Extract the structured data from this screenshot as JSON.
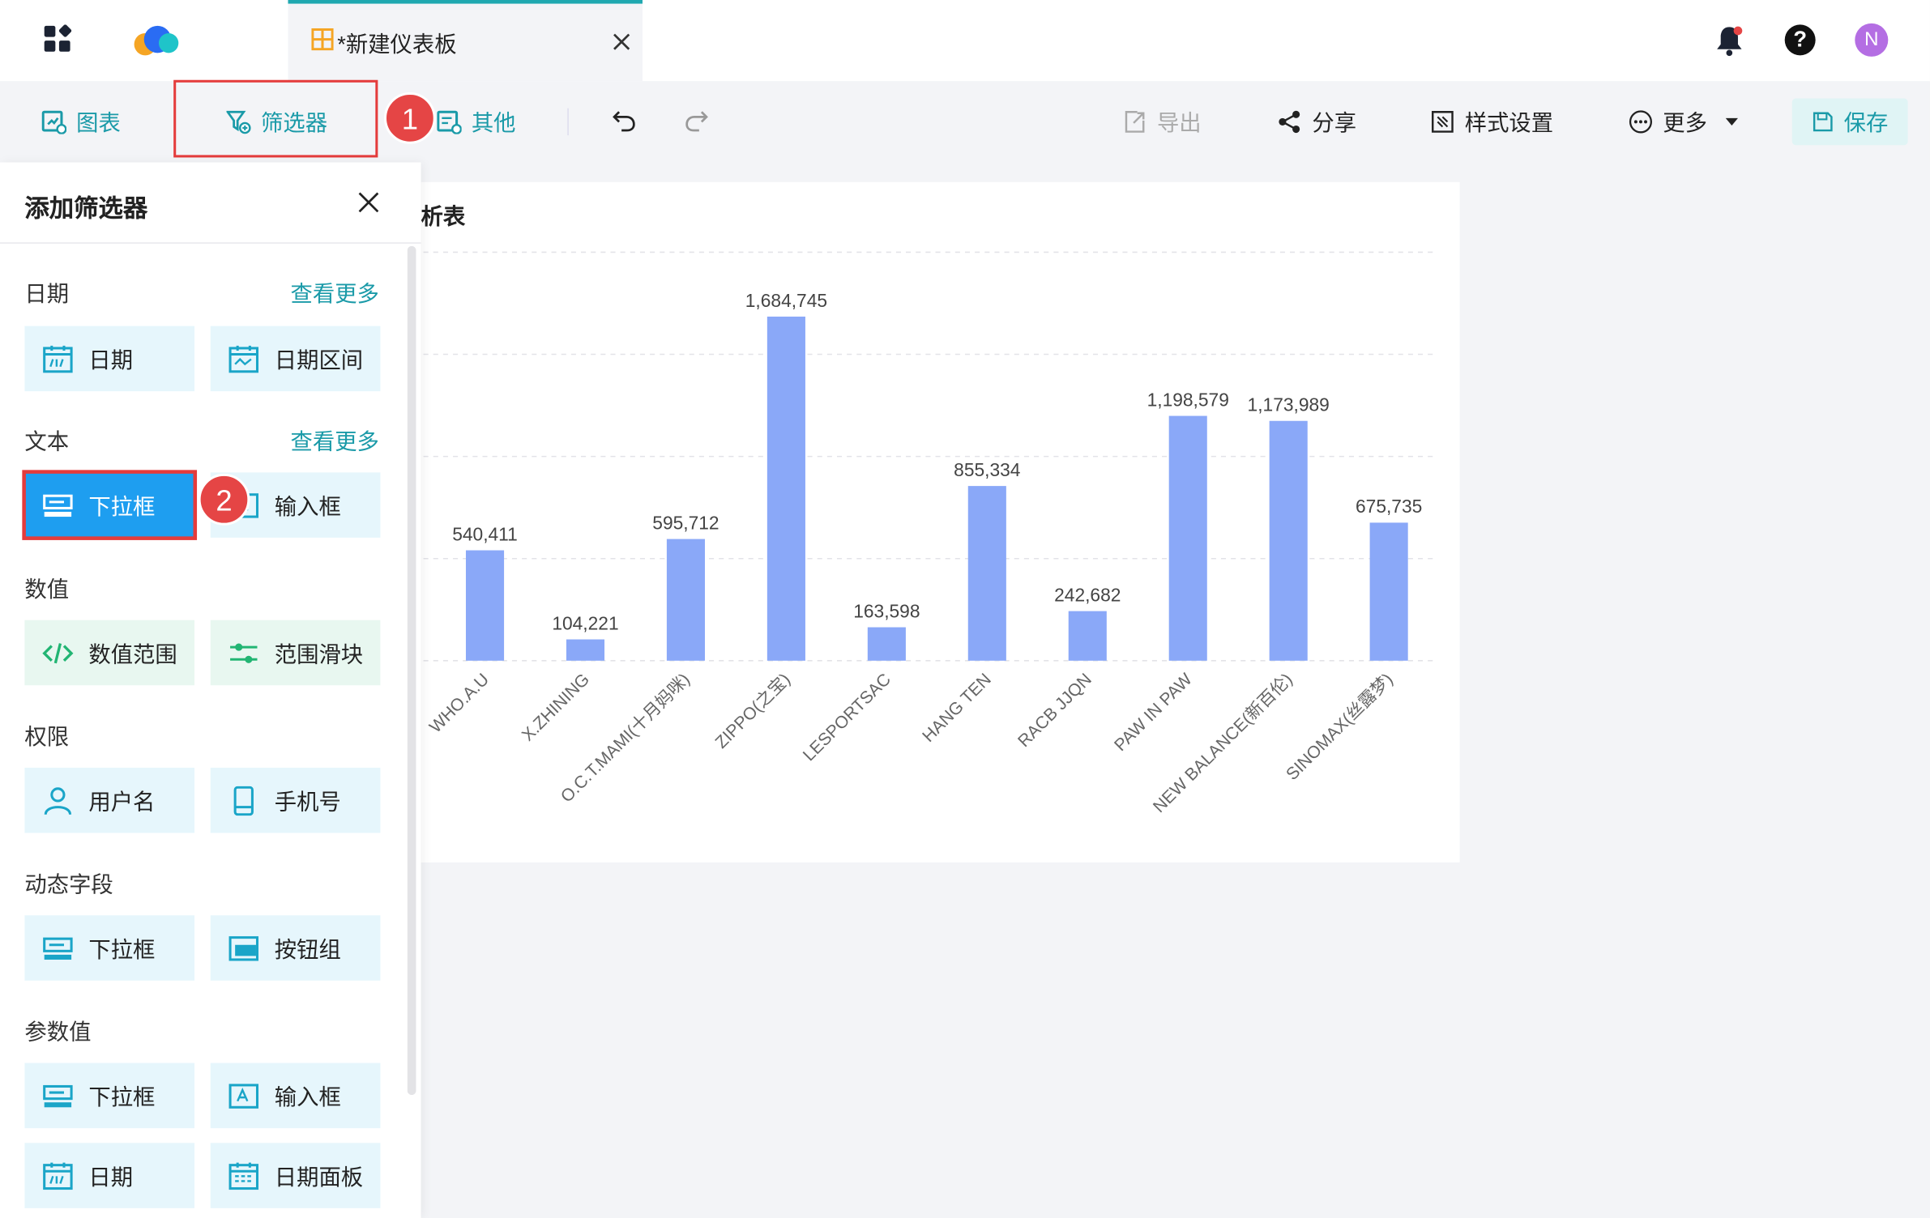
{
  "tab": {
    "title": "*新建仪表板"
  },
  "header": {
    "avatar_letter": "N",
    "help_label": "?"
  },
  "toolbar": {
    "chart_label": "图表",
    "filter_label": "筛选器",
    "other_label": "其他",
    "export_label": "导出",
    "share_label": "分享",
    "style_label": "样式设置",
    "more_label": "更多",
    "save_label": "保存",
    "annotation_1": "1"
  },
  "panel": {
    "title": "添加筛选器",
    "annotation_2": "2",
    "sections": [
      {
        "title": "日期",
        "more": "查看更多",
        "items": [
          "日期",
          "日期区间"
        ]
      },
      {
        "title": "文本",
        "more": "查看更多",
        "items": [
          "下拉框",
          "输入框"
        ]
      },
      {
        "title": "数值",
        "more": "",
        "items": [
          "数值范围",
          "范围滑块"
        ]
      },
      {
        "title": "权限",
        "more": "",
        "items": [
          "用户名",
          "手机号"
        ]
      },
      {
        "title": "动态字段",
        "more": "",
        "items": [
          "下拉框",
          "按钮组"
        ]
      },
      {
        "title": "参数值",
        "more": "",
        "items": [
          "下拉框",
          "输入框",
          "日期",
          "日期面板"
        ]
      }
    ]
  },
  "card": {
    "title_visible": "析表"
  },
  "colors": {
    "accent": "#1a9aa8",
    "bar": "#8aa8f8",
    "highlight": "#e43c3c",
    "selected": "#1e9ef0"
  },
  "chart_data": {
    "type": "bar",
    "categories": [
      "WHO.A.U",
      "X.ZHINING",
      "O.C.T.MAMI(十月妈咪)",
      "ZIPPO(之宝)",
      "LESPORTSAC",
      "HANG TEN",
      "RACB JJQN",
      "PAW IN PAW",
      "NEW BALANCE(新百伦)",
      "SINOMAX(丝露梦)"
    ],
    "values": [
      540411,
      104221,
      595712,
      1684745,
      163598,
      855334,
      242682,
      1198579,
      1173989,
      675735
    ],
    "value_labels": [
      "540,411",
      "104,221",
      "595,712",
      "1,684,745",
      "163,598",
      "855,334",
      "242,682",
      "1,198,579",
      "1,173,989",
      "675,735"
    ],
    "ylim": [
      0,
      2000000
    ],
    "ytick_count": 5,
    "grid": true,
    "xlabel": "",
    "ylabel": ""
  }
}
